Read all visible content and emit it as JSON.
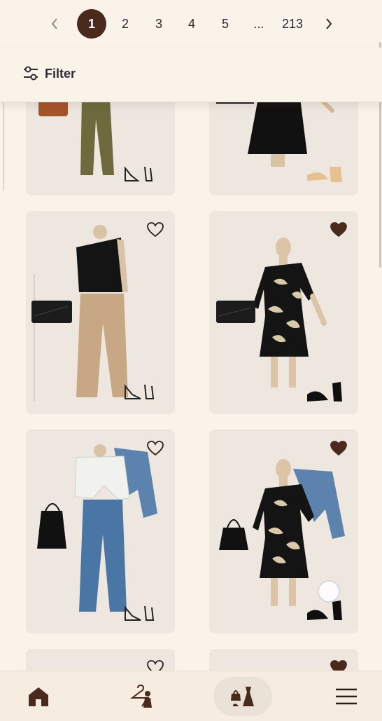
{
  "pagination": {
    "prev_icon": "chevron-left-icon",
    "pages": [
      "1",
      "2",
      "3",
      "4",
      "5",
      "...",
      "213"
    ],
    "active_page": "1",
    "next_icon": "chevron-right-icon"
  },
  "filter": {
    "label": "Filter",
    "icon": "sliders-icon"
  },
  "cards": [
    {
      "id": "outfit-olive-pants",
      "favorite": null
    },
    {
      "id": "outfit-black-dress",
      "favorite": null
    },
    {
      "id": "outfit-black-top-tan-pants",
      "favorite": false
    },
    {
      "id": "outfit-floral-dress-clutch",
      "favorite": true
    },
    {
      "id": "outfit-satin-wrap-jeans-denim-jacket",
      "favorite": false
    },
    {
      "id": "outfit-floral-dress-denim-jacket",
      "favorite": true
    },
    {
      "id": "outfit-partial-left",
      "favorite": false
    },
    {
      "id": "outfit-partial-right",
      "favorite": true
    }
  ],
  "bottom_nav": {
    "items": [
      {
        "name": "home",
        "icon": "home-icon",
        "active": false
      },
      {
        "name": "fitting",
        "icon": "hanger-person-icon",
        "active": false
      },
      {
        "name": "outfits",
        "icon": "outfit-bag-dress-icon",
        "active": true
      },
      {
        "name": "menu",
        "icon": "hamburger-menu-icon",
        "active": false
      }
    ]
  },
  "colors": {
    "background": "#faf3ea",
    "accent": "#4a2a1c",
    "card": "#ede7e0"
  }
}
